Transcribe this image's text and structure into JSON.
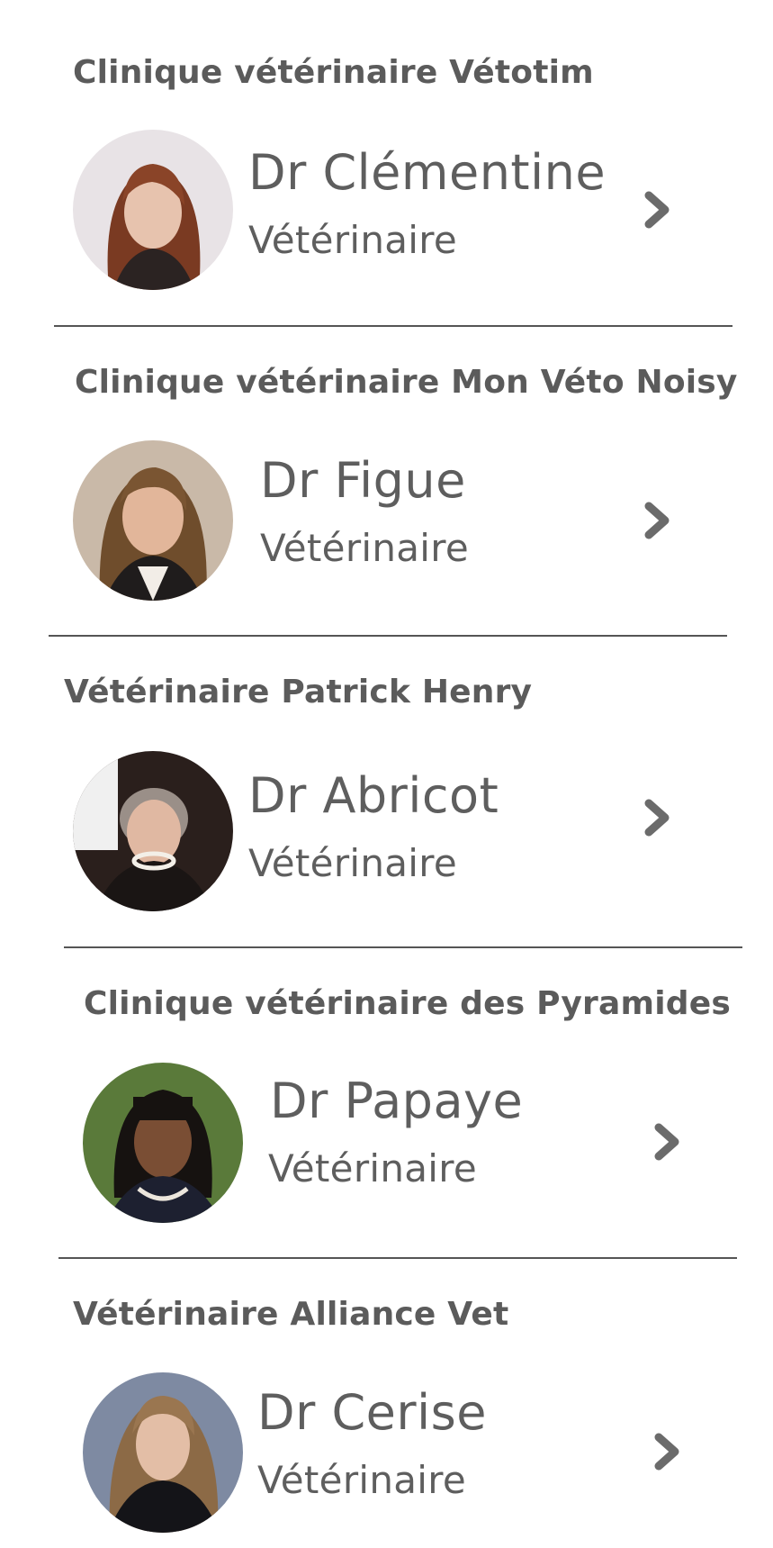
{
  "vets": [
    {
      "clinic": "Clinique vétérinaire Vétotim",
      "name": "Dr Clémentine",
      "role": "Vétérinaire",
      "avatar_icon": "person-avatar"
    },
    {
      "clinic": "Clinique vétérinaire Mon Véto Noisy",
      "name": "Dr Figue",
      "role": "Vétérinaire",
      "avatar_icon": "person-avatar"
    },
    {
      "clinic": "Vétérinaire Patrick Henry",
      "name": "Dr Abricot",
      "role": "Vétérinaire",
      "avatar_icon": "person-avatar"
    },
    {
      "clinic": "Clinique vétérinaire des Pyramides",
      "name": "Dr Papaye",
      "role": "Vétérinaire",
      "avatar_icon": "person-avatar"
    },
    {
      "clinic": "Vétérinaire Alliance Vet",
      "name": "Dr Cerise",
      "role": "Vétérinaire",
      "avatar_icon": "person-avatar"
    }
  ],
  "icons": {
    "open": "chevron-right-icon"
  },
  "colors": {
    "text": "#5a5a5a",
    "divider": "#555555",
    "chevron": "#6b6b6b"
  }
}
